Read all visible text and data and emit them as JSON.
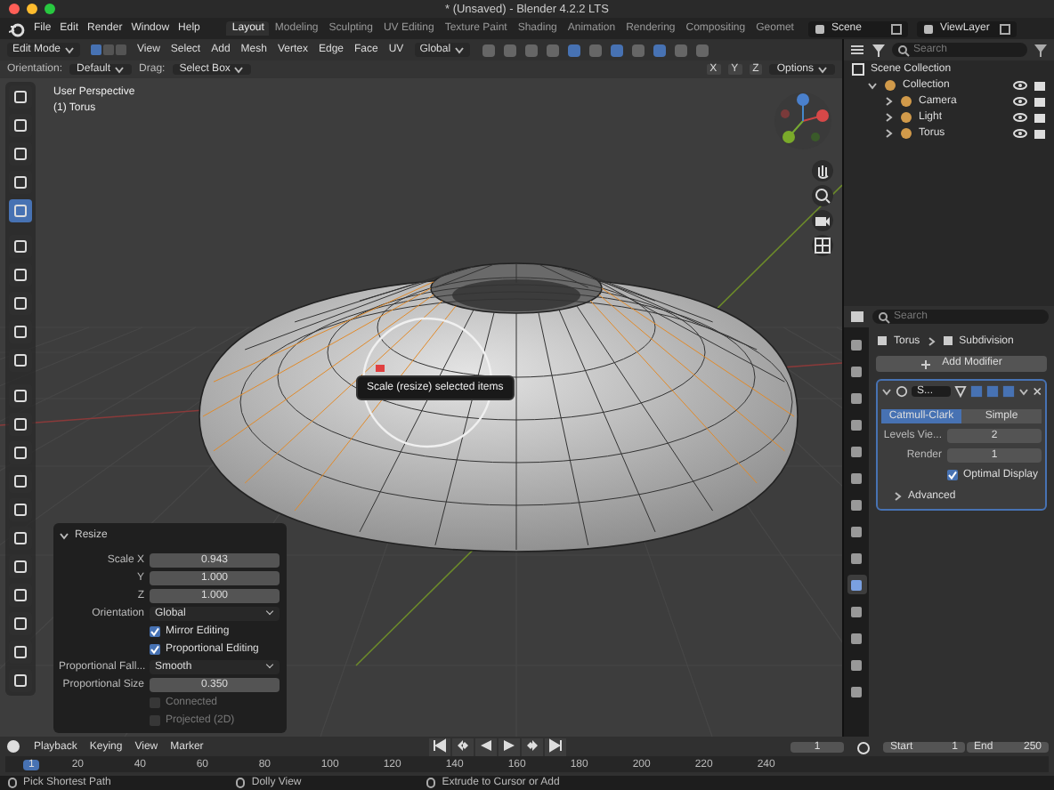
{
  "window": {
    "title": "* (Unsaved) - Blender 4.2.2 LTS"
  },
  "menu": [
    "File",
    "Edit",
    "Render",
    "Window",
    "Help"
  ],
  "workspaces": [
    {
      "label": "Layout",
      "selected": true
    },
    {
      "label": "Modeling",
      "selected": false
    },
    {
      "label": "Sculpting",
      "selected": false
    },
    {
      "label": "UV Editing",
      "selected": false
    },
    {
      "label": "Texture Paint",
      "selected": false
    },
    {
      "label": "Shading",
      "selected": false
    },
    {
      "label": "Animation",
      "selected": false
    },
    {
      "label": "Rendering",
      "selected": false
    },
    {
      "label": "Compositing",
      "selected": false
    },
    {
      "label": "Geomet",
      "selected": false
    }
  ],
  "scene": "Scene",
  "view_layer": "ViewLayer",
  "viewport": {
    "mode": "Edit Mode",
    "select_modes": [
      {
        "selected": true
      },
      {
        "selected": false
      },
      {
        "selected": false
      }
    ],
    "menus": [
      "View",
      "Select",
      "Add",
      "Mesh",
      "Vertex",
      "Edge",
      "Face",
      "UV"
    ],
    "transform_orientation": "Global",
    "orientation_label": "Orientation:",
    "orientation": "Default",
    "drag_label": "Drag:",
    "drag": "Select Box",
    "mirror_axes": [
      "X",
      "Y",
      "Z"
    ],
    "options": "Options",
    "view_name": "User Perspective",
    "object_name": "(1) Torus",
    "tooltip": "Scale (resize) selected items",
    "tools": [
      {
        "selected": false
      },
      {
        "selected": false
      },
      {
        "selected": false
      },
      {
        "selected": false
      },
      {
        "selected": true
      },
      {
        "selected": false
      },
      {
        "selected": false
      },
      {
        "selected": false
      },
      {
        "selected": false
      },
      {
        "selected": false
      },
      {
        "selected": false
      },
      {
        "selected": false
      },
      {
        "selected": false
      },
      {
        "selected": false
      },
      {
        "selected": false
      },
      {
        "selected": false
      },
      {
        "selected": false
      },
      {
        "selected": false
      },
      {
        "selected": false
      },
      {
        "selected": false
      },
      {
        "selected": false
      }
    ]
  },
  "operator_panel": {
    "title": "Resize",
    "expanded": true,
    "fields": [
      {
        "kind": "number",
        "label": "Scale X",
        "value": "0.943"
      },
      {
        "kind": "number",
        "label": "Y",
        "value": "1.000"
      },
      {
        "kind": "number",
        "label": "Z",
        "value": "1.000"
      },
      {
        "kind": "dropdown",
        "label": "Orientation",
        "value": "Global"
      },
      {
        "kind": "checkbox",
        "label": "Mirror Editing",
        "checked": true,
        "disabled": false
      },
      {
        "kind": "checkbox",
        "label": "Proportional Editing",
        "checked": true,
        "disabled": false
      },
      {
        "kind": "dropdown",
        "label": "Proportional Fall...",
        "value": "Smooth"
      },
      {
        "kind": "number",
        "label": "Proportional Size",
        "value": "0.350"
      },
      {
        "kind": "checkbox",
        "label": "Connected",
        "checked": false,
        "disabled": true
      },
      {
        "kind": "checkbox",
        "label": "Projected (2D)",
        "checked": false,
        "disabled": true
      }
    ]
  },
  "outliner": {
    "search_placeholder": "Search",
    "root": "Scene Collection",
    "items": [
      {
        "label": "Collection",
        "expanded": true,
        "children": [
          {
            "label": "Camera",
            "expanded": false
          },
          {
            "label": "Light",
            "expanded": false
          },
          {
            "label": "Torus",
            "expanded": false
          }
        ]
      }
    ]
  },
  "properties": {
    "search_placeholder": "Search",
    "breadcrumb": [
      "Torus",
      "Subdivision"
    ],
    "add_modifier": "Add Modifier",
    "tabs": [
      {
        "selected": false
      },
      {
        "selected": false
      },
      {
        "selected": false
      },
      {
        "selected": false
      },
      {
        "selected": false
      },
      {
        "selected": false
      },
      {
        "selected": false
      },
      {
        "selected": false
      },
      {
        "selected": false
      },
      {
        "selected": true
      },
      {
        "selected": false
      },
      {
        "selected": false
      },
      {
        "selected": false
      },
      {
        "selected": false
      }
    ],
    "modifier": {
      "name": "S...",
      "expanded": true,
      "types": [
        {
          "label": "Catmull-Clark",
          "selected": true
        },
        {
          "label": "Simple",
          "selected": false
        }
      ],
      "fields": [
        {
          "label": "Levels Vie...",
          "value": "2"
        },
        {
          "label": "Render",
          "value": "1"
        }
      ],
      "optimal_display": {
        "label": "Optimal Display",
        "checked": true
      },
      "advanced": {
        "label": "Advanced",
        "expanded": false
      }
    }
  },
  "timeline": {
    "menus": [
      "Playback",
      "Keying",
      "View",
      "Marker"
    ],
    "current_frame": "1",
    "start_label": "Start",
    "start": "1",
    "end_label": "End",
    "end": "250",
    "playhead": "1",
    "ruler": [
      "20",
      "40",
      "60",
      "80",
      "100",
      "120",
      "140",
      "160",
      "180",
      "200",
      "220",
      "240"
    ]
  },
  "status_bar": [
    "Pick Shortest Path",
    "Dolly View",
    "Extrude to Cursor or Add"
  ]
}
